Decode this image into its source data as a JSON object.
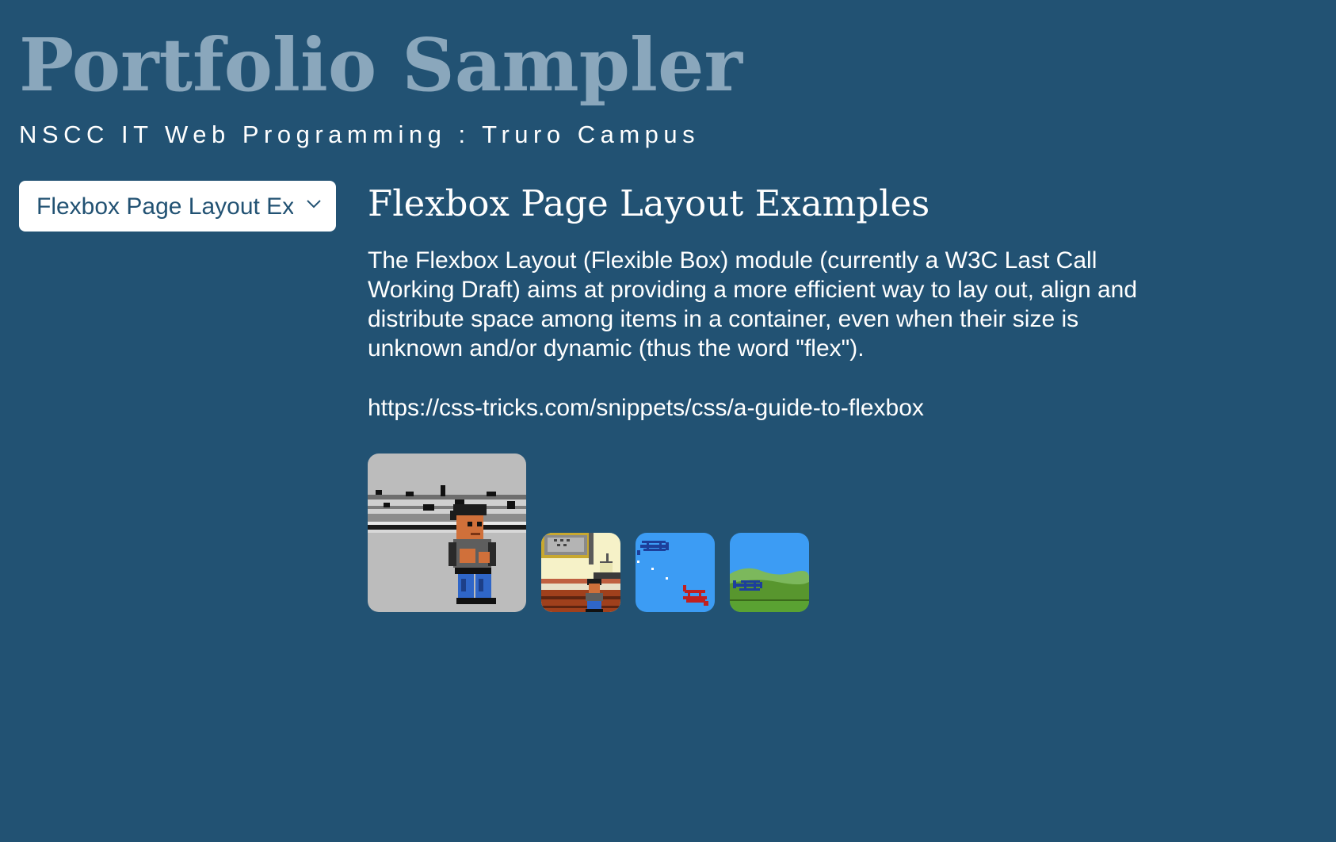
{
  "header": {
    "title": "Portfolio Sampler",
    "subtitle": "NSCC IT Web Programming : Truro Campus"
  },
  "nav": {
    "selected_page": "Flexbox Page Layout Examples",
    "options": [
      "Flexbox Page Layout Examples"
    ]
  },
  "main": {
    "heading": "Flexbox Page Layout Examples",
    "description": "The Flexbox Layout (Flexible Box) module (currently a W3C Last Call Working Draft) aims at providing a more efficient way to lay out, align and distribute space among items in a container, even when their size is unknown and/or dynamic (thus the word \"flex\").",
    "link": "https://css-tricks.com/snippets/css/a-guide-to-flexbox"
  },
  "gallery": {
    "thumbnails": [
      {
        "icon": "pixel-brawler-icon"
      },
      {
        "icon": "pixel-room-icon"
      },
      {
        "icon": "biplanes-sky-icon"
      },
      {
        "icon": "biplane-field-icon"
      }
    ]
  },
  "colors": {
    "background": "#225273",
    "title": "#8aa7bc",
    "text": "#ffffff",
    "select_text": "#225273"
  }
}
